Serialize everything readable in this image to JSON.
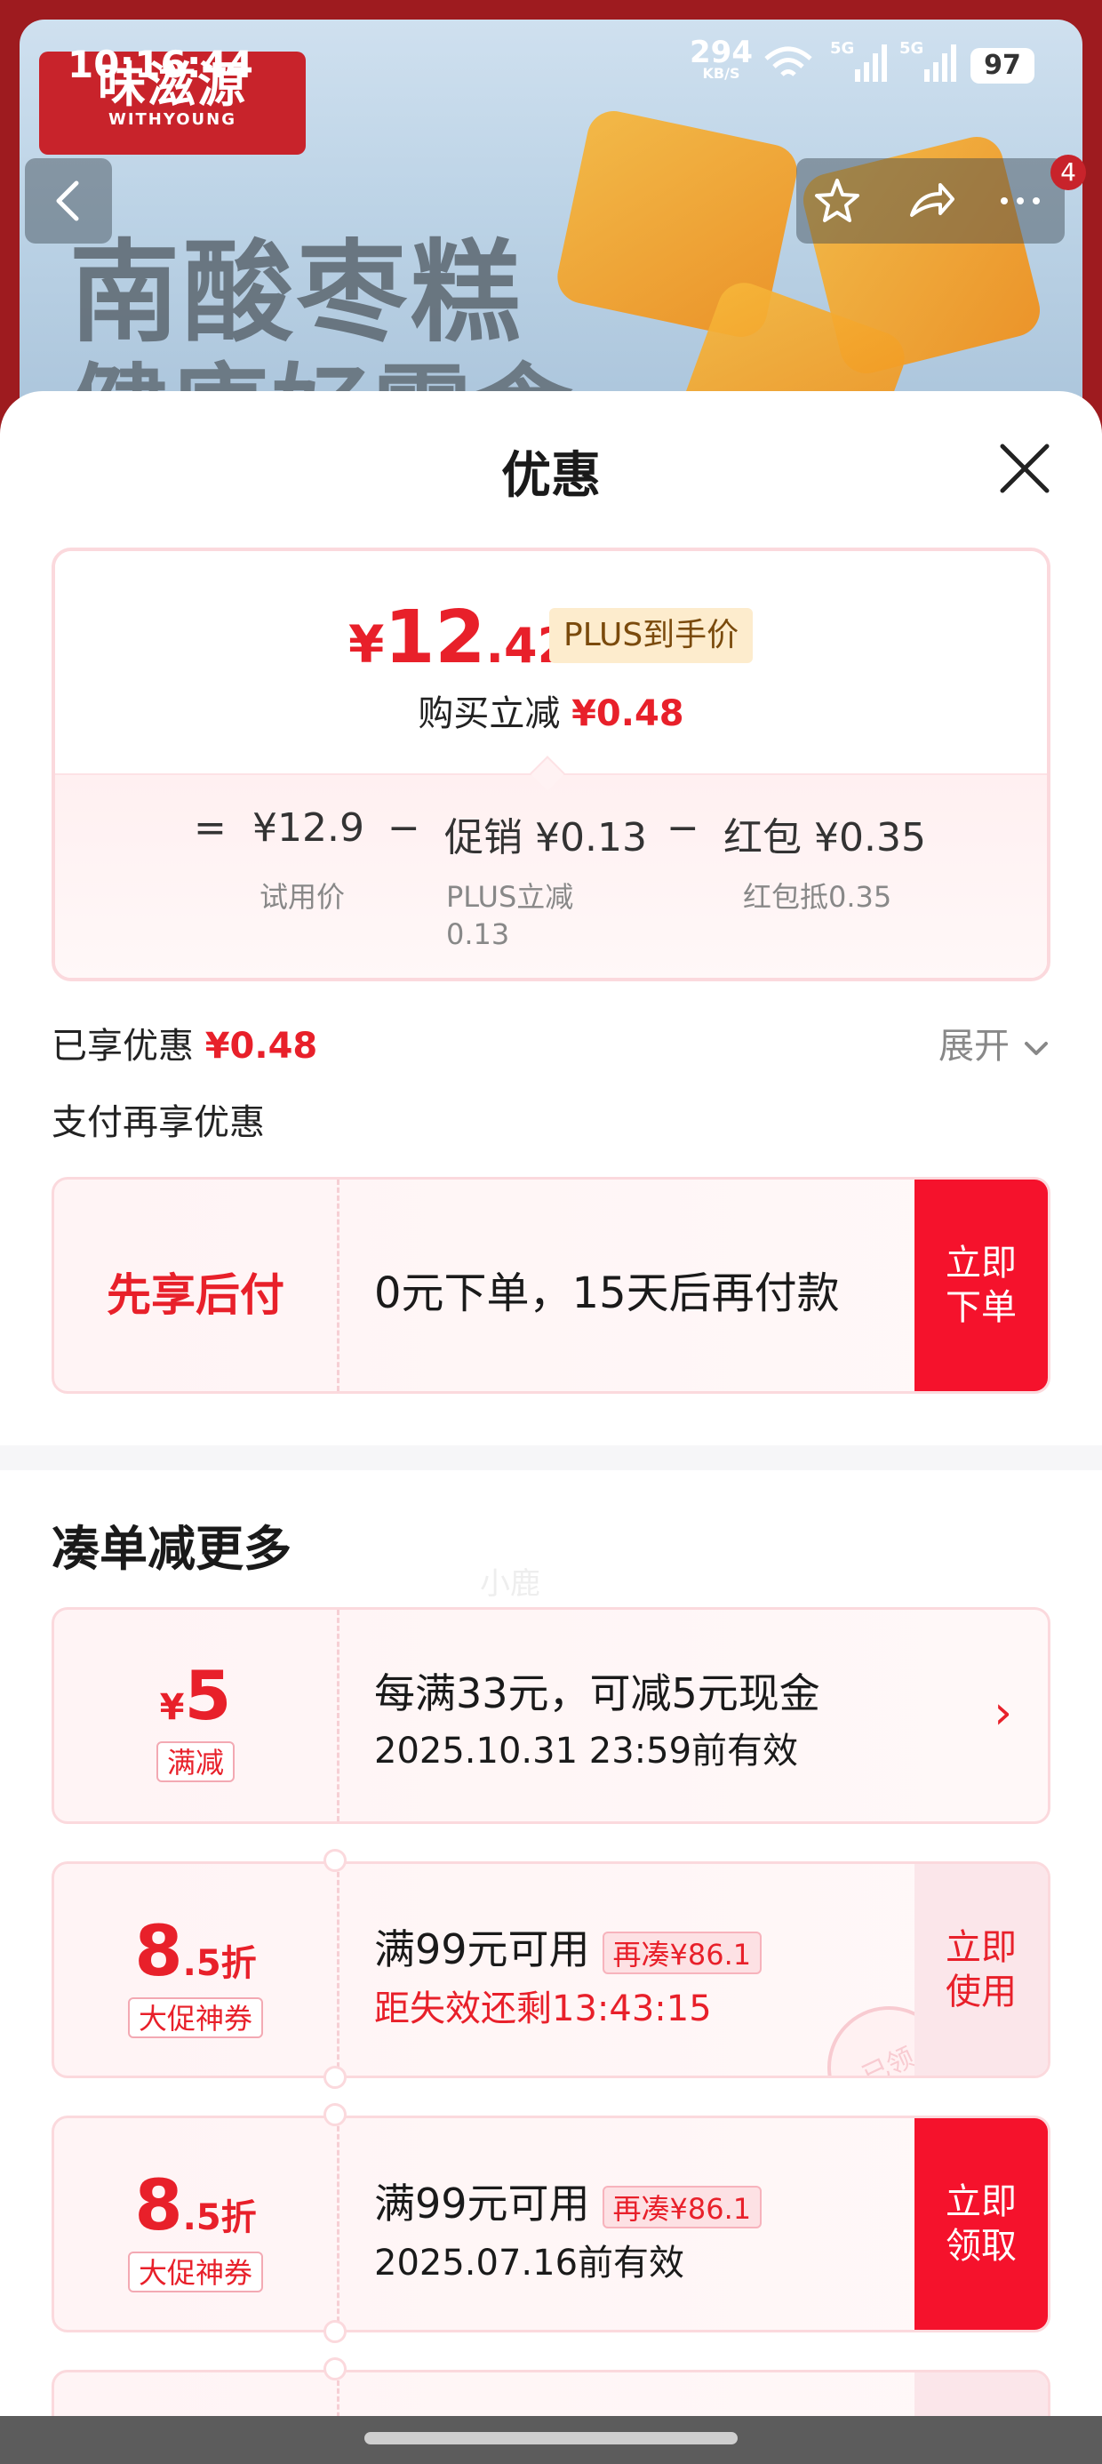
{
  "status_bar": {
    "time": "10:16:44",
    "speed_value": "294",
    "speed_unit": "KB/S",
    "signal1": "5G",
    "signal2": "5G",
    "battery": "97"
  },
  "background": {
    "brand_cn": "味滋源",
    "brand_en": "WITHYOUNG",
    "headline1": "南酸枣糕",
    "headline2": "健康好零食",
    "badge_count": "4"
  },
  "sheet": {
    "title": "优惠",
    "price_card": {
      "yen": "¥",
      "price_int": "12",
      "price_dec": ".42",
      "plus_tag": "PLUS到手价",
      "sub_label": "购买立减",
      "sub_value": "¥0.48",
      "eq": "=",
      "base_price": "¥12.9",
      "base_note": "试用价",
      "minus1": "−",
      "promo_label": "促销",
      "promo_value": "¥0.13",
      "promo_note": "PLUS立减0.13",
      "minus2": "−",
      "redpack_label": "红包",
      "redpack_value": "¥0.35",
      "redpack_note": "红包抵0.35"
    },
    "shared_label": "已享优惠",
    "shared_value": "¥0.48",
    "expand_label": "展开",
    "pay_again_label": "支付再享优惠",
    "watermark": "小鹿",
    "pay_later": {
      "left_title": "先享后付",
      "text": "0元下单，15天后再付款",
      "btn": "立即下单"
    },
    "section_title": "凑单减更多",
    "coupons": [
      {
        "yen": "¥",
        "amount": "5",
        "tag": "满减",
        "title": "每满33元，可减5元现金",
        "meta": "2025.10.31 23:59前有效",
        "action": "›"
      },
      {
        "big": "8",
        "small": ".5折",
        "tag": "大促神券",
        "title": "满99元可用",
        "more": "再凑¥86.1",
        "meta": "距失效还剩13:43:15",
        "btn": "立即使用",
        "stamp": "已领"
      },
      {
        "big": "8",
        "small": ".5折",
        "tag": "大促神券",
        "title": "满99元可用",
        "more": "再凑¥86.1",
        "meta": "2025.07.16前有效",
        "btn": "立即领取"
      }
    ]
  },
  "colors": {
    "accent_red": "#e8202a",
    "button_red": "#f5122c",
    "card_border": "#fbd9dd",
    "plus_tag_bg": "#fdeccd"
  }
}
